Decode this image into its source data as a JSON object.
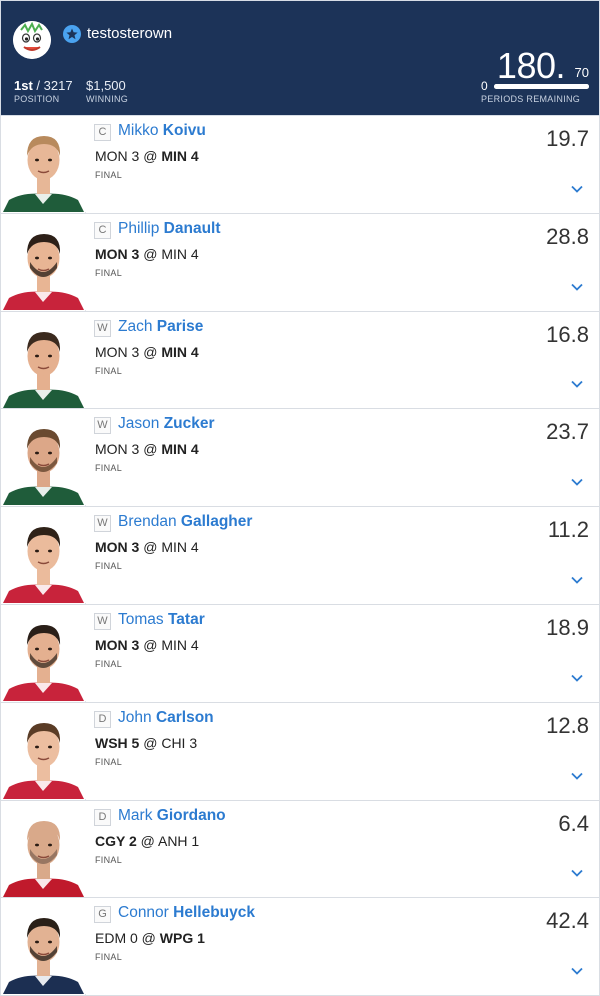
{
  "header": {
    "username": "testosterown",
    "position_value": "1st",
    "position_total": "/ 3217",
    "position_label": "POSITION",
    "winning_value": "$1,500",
    "winning_label": "WINNING",
    "score_main": "180.",
    "score_decimal": "70",
    "periods_value": "0",
    "periods_label": "PERIODS REMAINING",
    "periods_progress": 1.0,
    "colors": {
      "background": "#1c3358",
      "accent": "#4aa3f0"
    }
  },
  "players": [
    {
      "pos": "C",
      "first": "Mikko",
      "last": "Koivu",
      "game_pre": "MON 3 @ ",
      "game_bold": "MIN 4",
      "game_post": "",
      "bold_first": false,
      "status": "FINAL",
      "points": "19.7",
      "jersey": "#1f5c3a",
      "skin": "#e7b797",
      "hair": "#b88a5d",
      "beard": ""
    },
    {
      "pos": "C",
      "first": "Phillip",
      "last": "Danault",
      "game_pre": "",
      "game_bold": "MON 3",
      "game_post": " @ MIN 4",
      "bold_first": true,
      "status": "FINAL",
      "points": "28.8",
      "jersey": "#c8233b",
      "skin": "#e8b594",
      "hair": "#2d2018",
      "beard": "#3a2b22"
    },
    {
      "pos": "W",
      "first": "Zach",
      "last": "Parise",
      "game_pre": "MON 3 @ ",
      "game_bold": "MIN 4",
      "game_post": "",
      "bold_first": false,
      "status": "FINAL",
      "points": "16.8",
      "jersey": "#1f5c3a",
      "skin": "#e5b08f",
      "hair": "#3b2a1e",
      "beard": ""
    },
    {
      "pos": "W",
      "first": "Jason",
      "last": "Zucker",
      "game_pre": "MON 3 @ ",
      "game_bold": "MIN 4",
      "game_post": "",
      "bold_first": false,
      "status": "FINAL",
      "points": "23.7",
      "jersey": "#1f5c3a",
      "skin": "#dca788",
      "hair": "#6a4a30",
      "beard": "#6b4a32"
    },
    {
      "pos": "W",
      "first": "Brendan",
      "last": "Gallagher",
      "game_pre": "",
      "game_bold": "MON 3",
      "game_post": " @ MIN 4",
      "bold_first": true,
      "status": "FINAL",
      "points": "11.2",
      "jersey": "#c8233b",
      "skin": "#ebbb9c",
      "hair": "#2f2218",
      "beard": ""
    },
    {
      "pos": "W",
      "first": "Tomas",
      "last": "Tatar",
      "game_pre": "",
      "game_bold": "MON 3",
      "game_post": " @ MIN 4",
      "bold_first": true,
      "status": "FINAL",
      "points": "18.9",
      "jersey": "#c8233b",
      "skin": "#e4b090",
      "hair": "#2a1f18",
      "beard": "#4a3a2e"
    },
    {
      "pos": "D",
      "first": "John",
      "last": "Carlson",
      "game_pre": "",
      "game_bold": "WSH 5",
      "game_post": " @ CHI 3",
      "bold_first": true,
      "status": "FINAL",
      "points": "12.8",
      "jersey": "#c8233b",
      "skin": "#ecbea0",
      "hair": "#5a3c26",
      "beard": ""
    },
    {
      "pos": "D",
      "first": "Mark",
      "last": "Giordano",
      "game_pre": "",
      "game_bold": "CGY 2",
      "game_post": " @ ANH 1",
      "bold_first": true,
      "status": "FINAL",
      "points": "6.4",
      "jersey": "#c01a2c",
      "skin": "#d9a98a",
      "hair": "#d9a98a",
      "beard": "#8c6d5a"
    },
    {
      "pos": "G",
      "first": "Connor",
      "last": "Hellebuyck",
      "game_pre": "EDM 0 @ ",
      "game_bold": "WPG 1",
      "game_post": "",
      "bold_first": false,
      "status": "FINAL",
      "points": "42.4",
      "jersey": "#1c2f52",
      "skin": "#e2b293",
      "hair": "#2a2018",
      "beard": "#3a2e26"
    }
  ]
}
